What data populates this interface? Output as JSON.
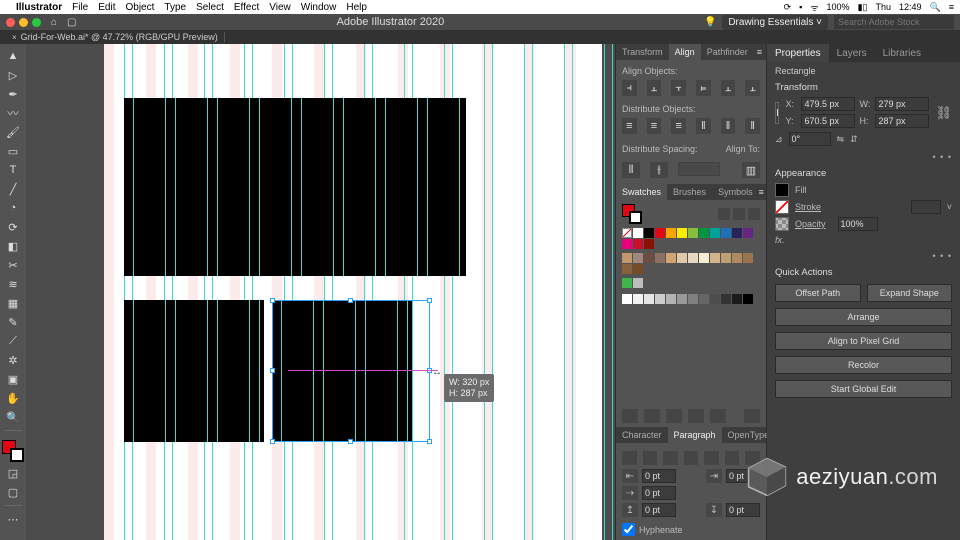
{
  "mac_menu": {
    "app": "Illustrator",
    "items": [
      "File",
      "Edit",
      "Object",
      "Type",
      "Select",
      "Effect",
      "View",
      "Window",
      "Help"
    ],
    "right": {
      "battery": "100%",
      "day": "Thu",
      "time": "12:49"
    }
  },
  "app_bar": {
    "title": "Adobe Illustrator 2020",
    "workspace": "Drawing Essentials",
    "search_placeholder": "Search Adobe Stock"
  },
  "doc_tab": {
    "name": "Grid-For-Web.ai* @ 47.72% (RGB/GPU Preview)"
  },
  "canvas": {
    "size_tip_w": "W: 320 px",
    "size_tip_h": "H: 287 px"
  },
  "align_panel": {
    "tabs": [
      "Transform",
      "Align",
      "Pathfinder"
    ],
    "active": "Align",
    "align_objects_label": "Align Objects:",
    "distribute_objects_label": "Distribute Objects:",
    "distribute_spacing_label": "Distribute Spacing:",
    "align_to_label": "Align To:"
  },
  "swatches_panel": {
    "tabs": [
      "Swatches",
      "Brushes",
      "Symbols"
    ],
    "active": "Swatches",
    "colors_row1": [
      "#ffffff",
      "#000000",
      "#e30613",
      "#f7a600",
      "#ffed00",
      "#86bc40",
      "#009640",
      "#00a19a",
      "#1d71b8",
      "#29235c",
      "#662483",
      "#e6007e",
      "#c8102e",
      "#8a1002"
    ],
    "colors_row2": [
      "#c1976b",
      "#a1887f",
      "#6d4c41",
      "#8d6e63",
      "#d4a373",
      "#e0c9a6",
      "#ead7c1",
      "#f8ecd4",
      "#d2b48c",
      "#bfa074",
      "#ad8a60",
      "#9a754d",
      "#876139",
      "#744c25"
    ],
    "colors_row3": [
      "#3fb54a",
      "#bdbdbd"
    ],
    "grays": [
      "#ffffff",
      "#f2f2f2",
      "#e6e6e6",
      "#cccccc",
      "#b3b3b3",
      "#999999",
      "#808080",
      "#666666",
      "#4d4d4d",
      "#333333",
      "#1a1a1a",
      "#000000"
    ]
  },
  "type_panel": {
    "tabs": [
      "Character",
      "Paragraph",
      "OpenType"
    ],
    "active": "Paragraph",
    "indent_left": "0 pt",
    "indent_right": "0 pt",
    "indent_first": "0 pt",
    "space_before": "0 pt",
    "space_after": "0 pt",
    "hyphenate_label": "Hyphenate"
  },
  "properties": {
    "tabs": [
      "Properties",
      "Layers",
      "Libraries"
    ],
    "active": "Properties",
    "selection": "Rectangle",
    "transform_label": "Transform",
    "x": "479.5 px",
    "w": "279 px",
    "y": "670.5 px",
    "h": "287 px",
    "rotate": "0°",
    "appearance_label": "Appearance",
    "fill_label": "Fill",
    "stroke_label": "Stroke",
    "opacity_label": "Opacity",
    "opacity_value": "100%",
    "fx_label": "fx.",
    "quick_actions_label": "Quick Actions",
    "offset_path": "Offset Path",
    "expand_shape": "Expand Shape",
    "arrange": "Arrange",
    "align_pixel": "Align to Pixel Grid",
    "recolor": "Recolor",
    "start_global_edit": "Start Global Edit"
  },
  "watermark": {
    "text": "aeziyuan",
    "suffix": ".com"
  }
}
